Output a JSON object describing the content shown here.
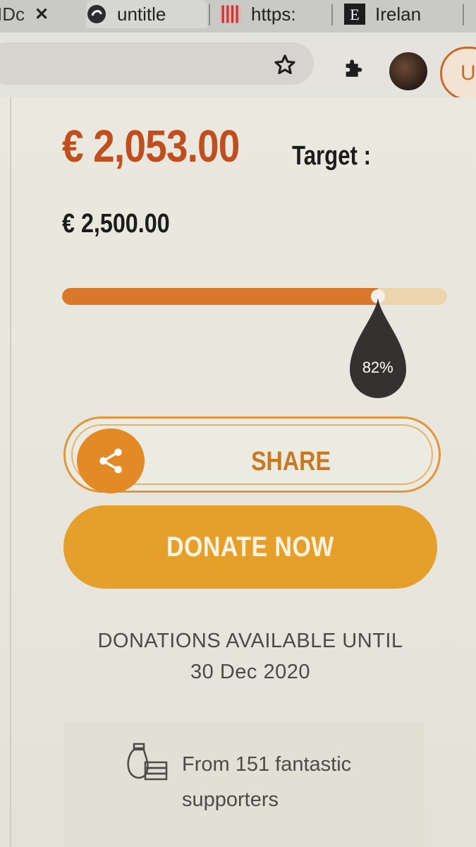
{
  "browser": {
    "tabs": [
      {
        "label": "IDc",
        "icon": "close-icon"
      },
      {
        "label": "untitle",
        "icon": "app-favicon"
      },
      {
        "label": "https:",
        "icon": "striped-favicon"
      },
      {
        "label": "Irelan",
        "icon": "letter-e-favicon"
      }
    ],
    "close_glyph": "✕",
    "toolbar": {
      "bookmark_icon": "star-icon",
      "extensions_icon": "puzzle-icon",
      "avatar_icon": "avatar",
      "profile_label": "U"
    }
  },
  "campaign": {
    "raised": "€ 2,053.00",
    "target_label": "Target :",
    "target_value": "€ 2,500.00",
    "progress_percent": 82,
    "progress_label": "82%",
    "share_label": "SHARE",
    "donate_label": "DONATE NOW",
    "until_line1": "DONATIONS AVAILABLE UNTIL",
    "until_line2": "30 Dec 2020",
    "supporters_line1": "From 151 fantastic",
    "supporters_line2": "supporters"
  },
  "colors": {
    "accent_orange": "#d9772a",
    "raised_red": "#bf4f1e",
    "donate_gold": "#e4a02a",
    "tooltip_dark": "#343131"
  }
}
